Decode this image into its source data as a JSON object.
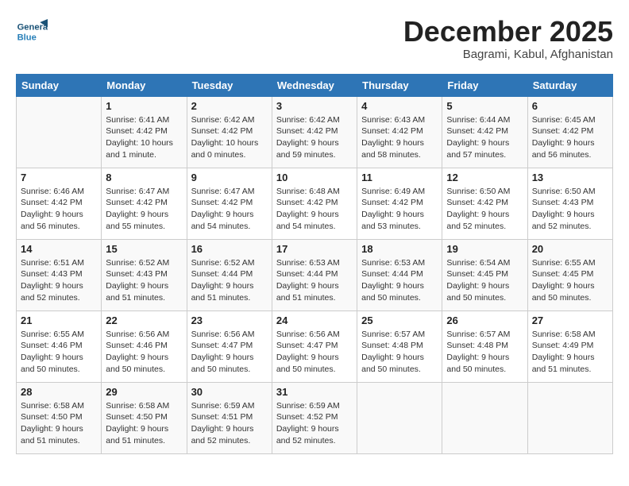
{
  "header": {
    "logo_general": "General",
    "logo_blue": "Blue",
    "month_title": "December 2025",
    "location": "Bagrami, Kabul, Afghanistan"
  },
  "days_of_week": [
    "Sunday",
    "Monday",
    "Tuesday",
    "Wednesday",
    "Thursday",
    "Friday",
    "Saturday"
  ],
  "weeks": [
    [
      {
        "day": "",
        "info": ""
      },
      {
        "day": "1",
        "info": "Sunrise: 6:41 AM\nSunset: 4:42 PM\nDaylight: 10 hours\nand 1 minute."
      },
      {
        "day": "2",
        "info": "Sunrise: 6:42 AM\nSunset: 4:42 PM\nDaylight: 10 hours\nand 0 minutes."
      },
      {
        "day": "3",
        "info": "Sunrise: 6:42 AM\nSunset: 4:42 PM\nDaylight: 9 hours\nand 59 minutes."
      },
      {
        "day": "4",
        "info": "Sunrise: 6:43 AM\nSunset: 4:42 PM\nDaylight: 9 hours\nand 58 minutes."
      },
      {
        "day": "5",
        "info": "Sunrise: 6:44 AM\nSunset: 4:42 PM\nDaylight: 9 hours\nand 57 minutes."
      },
      {
        "day": "6",
        "info": "Sunrise: 6:45 AM\nSunset: 4:42 PM\nDaylight: 9 hours\nand 56 minutes."
      }
    ],
    [
      {
        "day": "7",
        "info": "Sunrise: 6:46 AM\nSunset: 4:42 PM\nDaylight: 9 hours\nand 56 minutes."
      },
      {
        "day": "8",
        "info": "Sunrise: 6:47 AM\nSunset: 4:42 PM\nDaylight: 9 hours\nand 55 minutes."
      },
      {
        "day": "9",
        "info": "Sunrise: 6:47 AM\nSunset: 4:42 PM\nDaylight: 9 hours\nand 54 minutes."
      },
      {
        "day": "10",
        "info": "Sunrise: 6:48 AM\nSunset: 4:42 PM\nDaylight: 9 hours\nand 54 minutes."
      },
      {
        "day": "11",
        "info": "Sunrise: 6:49 AM\nSunset: 4:42 PM\nDaylight: 9 hours\nand 53 minutes."
      },
      {
        "day": "12",
        "info": "Sunrise: 6:50 AM\nSunset: 4:42 PM\nDaylight: 9 hours\nand 52 minutes."
      },
      {
        "day": "13",
        "info": "Sunrise: 6:50 AM\nSunset: 4:43 PM\nDaylight: 9 hours\nand 52 minutes."
      }
    ],
    [
      {
        "day": "14",
        "info": "Sunrise: 6:51 AM\nSunset: 4:43 PM\nDaylight: 9 hours\nand 52 minutes."
      },
      {
        "day": "15",
        "info": "Sunrise: 6:52 AM\nSunset: 4:43 PM\nDaylight: 9 hours\nand 51 minutes."
      },
      {
        "day": "16",
        "info": "Sunrise: 6:52 AM\nSunset: 4:44 PM\nDaylight: 9 hours\nand 51 minutes."
      },
      {
        "day": "17",
        "info": "Sunrise: 6:53 AM\nSunset: 4:44 PM\nDaylight: 9 hours\nand 51 minutes."
      },
      {
        "day": "18",
        "info": "Sunrise: 6:53 AM\nSunset: 4:44 PM\nDaylight: 9 hours\nand 50 minutes."
      },
      {
        "day": "19",
        "info": "Sunrise: 6:54 AM\nSunset: 4:45 PM\nDaylight: 9 hours\nand 50 minutes."
      },
      {
        "day": "20",
        "info": "Sunrise: 6:55 AM\nSunset: 4:45 PM\nDaylight: 9 hours\nand 50 minutes."
      }
    ],
    [
      {
        "day": "21",
        "info": "Sunrise: 6:55 AM\nSunset: 4:46 PM\nDaylight: 9 hours\nand 50 minutes."
      },
      {
        "day": "22",
        "info": "Sunrise: 6:56 AM\nSunset: 4:46 PM\nDaylight: 9 hours\nand 50 minutes."
      },
      {
        "day": "23",
        "info": "Sunrise: 6:56 AM\nSunset: 4:47 PM\nDaylight: 9 hours\nand 50 minutes."
      },
      {
        "day": "24",
        "info": "Sunrise: 6:56 AM\nSunset: 4:47 PM\nDaylight: 9 hours\nand 50 minutes."
      },
      {
        "day": "25",
        "info": "Sunrise: 6:57 AM\nSunset: 4:48 PM\nDaylight: 9 hours\nand 50 minutes."
      },
      {
        "day": "26",
        "info": "Sunrise: 6:57 AM\nSunset: 4:48 PM\nDaylight: 9 hours\nand 50 minutes."
      },
      {
        "day": "27",
        "info": "Sunrise: 6:58 AM\nSunset: 4:49 PM\nDaylight: 9 hours\nand 51 minutes."
      }
    ],
    [
      {
        "day": "28",
        "info": "Sunrise: 6:58 AM\nSunset: 4:50 PM\nDaylight: 9 hours\nand 51 minutes."
      },
      {
        "day": "29",
        "info": "Sunrise: 6:58 AM\nSunset: 4:50 PM\nDaylight: 9 hours\nand 51 minutes."
      },
      {
        "day": "30",
        "info": "Sunrise: 6:59 AM\nSunset: 4:51 PM\nDaylight: 9 hours\nand 52 minutes."
      },
      {
        "day": "31",
        "info": "Sunrise: 6:59 AM\nSunset: 4:52 PM\nDaylight: 9 hours\nand 52 minutes."
      },
      {
        "day": "",
        "info": ""
      },
      {
        "day": "",
        "info": ""
      },
      {
        "day": "",
        "info": ""
      }
    ]
  ]
}
